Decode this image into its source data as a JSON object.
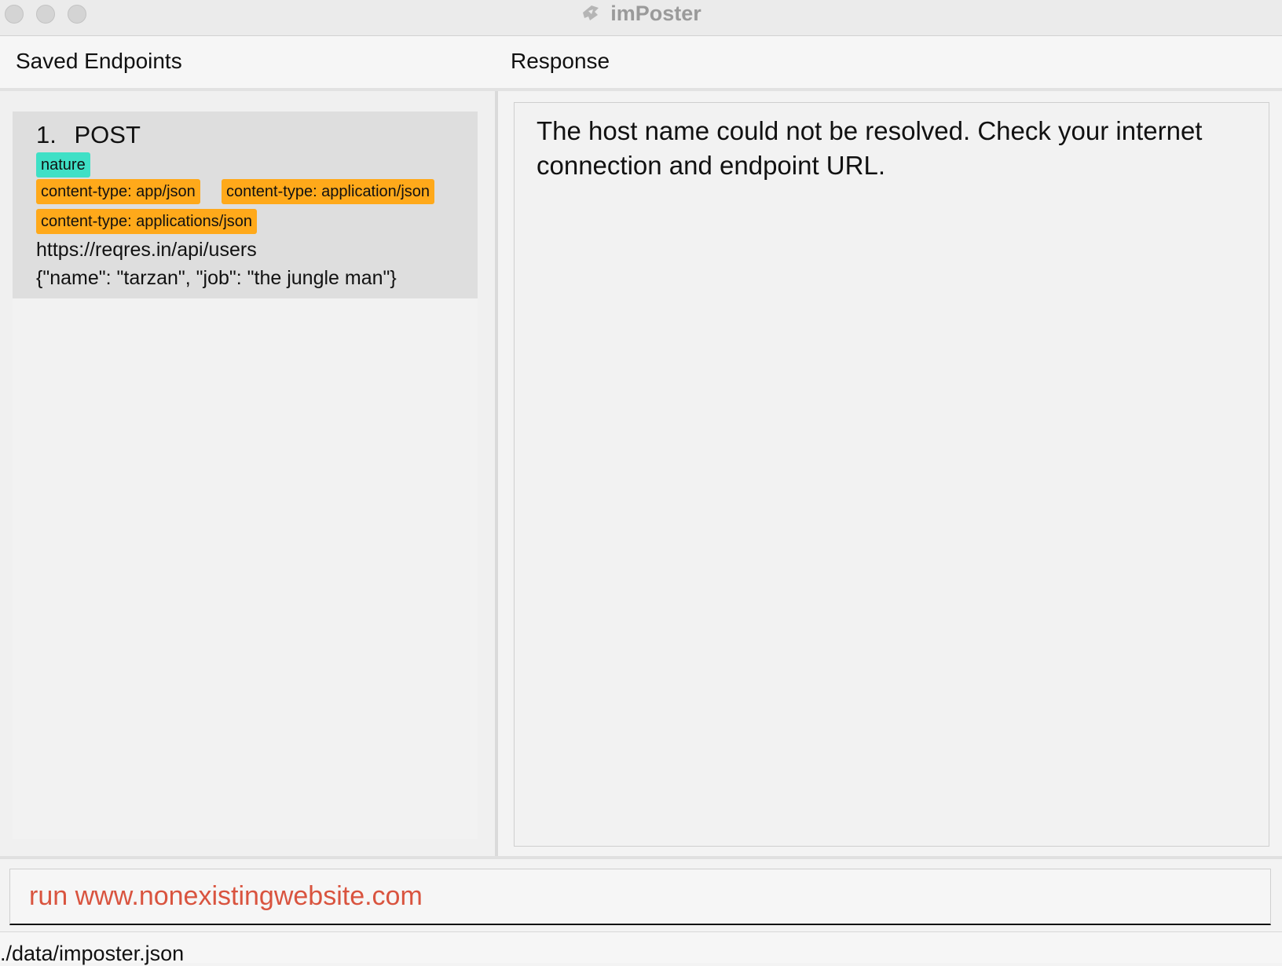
{
  "window": {
    "title": "imPoster",
    "logo_icon": "poster-logo-icon"
  },
  "left_pane": {
    "title": "Saved Endpoints",
    "endpoints": [
      {
        "index": "1.",
        "method": "POST",
        "tags": [
          "nature"
        ],
        "headers": [
          "content-type: app/json",
          "content-type: application/json",
          "content-type: applications/json"
        ],
        "url": "https://reqres.in/api/users",
        "body": "{\"name\": \"tarzan\", \"job\": \"the jungle man\"}"
      }
    ]
  },
  "right_pane": {
    "title": "Response",
    "message": "The host name could not be resolved. Check your internet connection and endpoint URL."
  },
  "command": {
    "value": "run www.nonexistingwebsite.com"
  },
  "status_bar": {
    "file_path": "./data/imposter.json"
  },
  "colors": {
    "tag": "#3fe0c6",
    "header": "#ffa91a",
    "command_text": "#d9543f"
  }
}
